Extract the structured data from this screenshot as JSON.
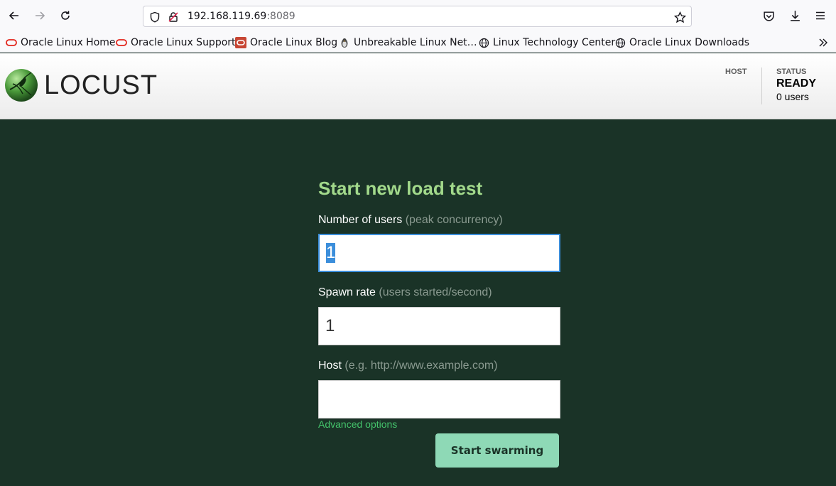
{
  "browser": {
    "url_host": "192.168.119.69",
    "url_port": ":8089",
    "bookmarks": [
      {
        "label": "Oracle Linux Home",
        "icon": "oracle-icon"
      },
      {
        "label": "Oracle Linux Support",
        "icon": "oracle-icon"
      },
      {
        "label": "Oracle Linux Blog",
        "icon": "oracle-blog-icon"
      },
      {
        "label": "Unbreakable Linux Net…",
        "icon": "penguin-icon"
      },
      {
        "label": "Linux Technology Center",
        "icon": "globe-icon"
      },
      {
        "label": "Oracle Linux Downloads",
        "icon": "globe-icon"
      }
    ]
  },
  "header": {
    "logo_text": "LOCUST",
    "host_label": "HOST",
    "status_label": "STATUS",
    "status_value": "READY",
    "users_text": "0 users"
  },
  "form": {
    "title": "Start new load test",
    "users_label": "Number of users",
    "users_hint": "(peak concurrency)",
    "users_value": "1",
    "rate_label": "Spawn rate",
    "rate_hint": "(users started/second)",
    "rate_value": "1",
    "host_label": "Host",
    "host_hint": "(e.g. http://www.example.com)",
    "host_value": "",
    "advanced_label": "Advanced options",
    "submit_label": "Start swarming"
  },
  "colors": {
    "page_bg": "#1a3327",
    "title_green": "#a2d98b",
    "button_bg": "#8ed9b6",
    "link_green": "#44c36b"
  }
}
